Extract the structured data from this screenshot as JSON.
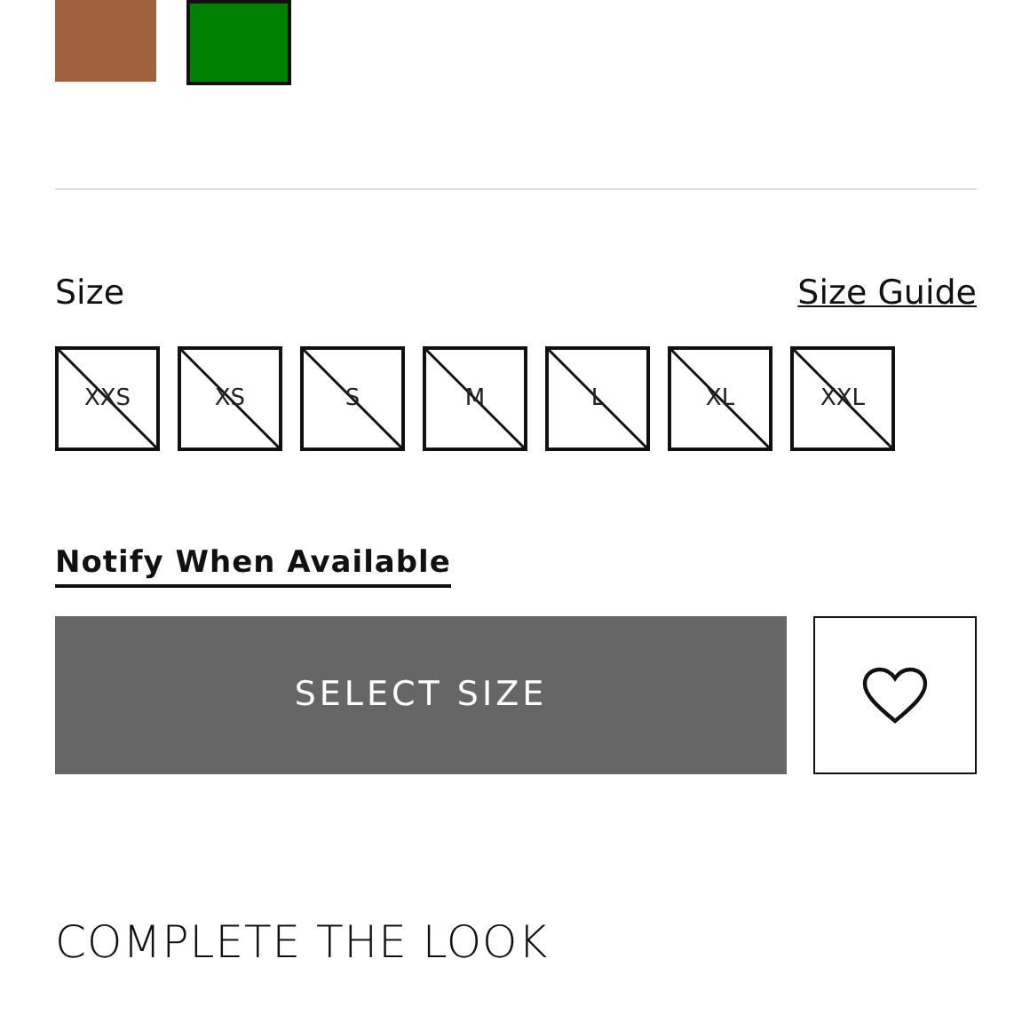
{
  "swatches": [
    {
      "color": "#a0613f",
      "selected": false
    },
    {
      "color": "#008000",
      "selected": true
    }
  ],
  "size_label": "Size",
  "size_guide": "Size Guide",
  "sizes": [
    {
      "label": "XXS",
      "available": false
    },
    {
      "label": "XS",
      "available": false
    },
    {
      "label": "S",
      "available": false
    },
    {
      "label": "M",
      "available": false
    },
    {
      "label": "L",
      "available": false
    },
    {
      "label": "XL",
      "available": false
    },
    {
      "label": "XXL",
      "available": false
    }
  ],
  "notify_link": "Notify When Available",
  "select_button": "SELECT SIZE",
  "section_title": "COMPLETE THE LOOK"
}
